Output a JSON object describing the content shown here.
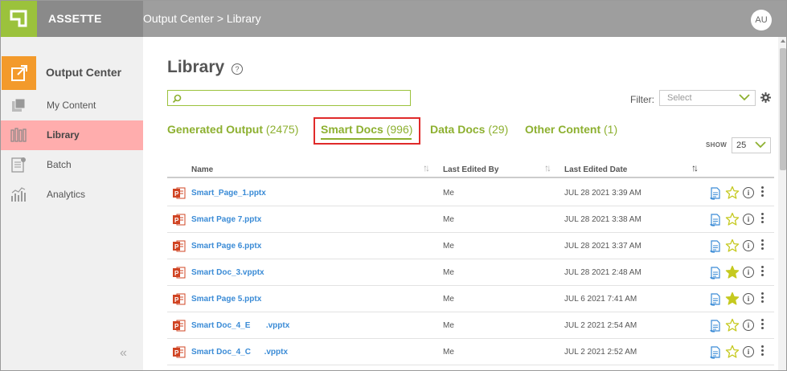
{
  "app": {
    "brand": "ASSETTE",
    "breadcrumb": "Output Center > Library",
    "user_initials": "AU"
  },
  "sidebar": {
    "header": {
      "label": "Output Center",
      "icon": "export-icon",
      "color": "#f39a2b"
    },
    "items": [
      {
        "label": "My Content",
        "icon": "my-content-icon"
      },
      {
        "label": "Library",
        "icon": "library-icon",
        "active": true
      },
      {
        "label": "Batch",
        "icon": "batch-icon"
      },
      {
        "label": "Analytics",
        "icon": "analytics-icon"
      }
    ],
    "collapse_glyph": "«"
  },
  "main": {
    "title": "Library",
    "help_glyph": "?",
    "search": {
      "value": "",
      "placeholder": ""
    },
    "filter": {
      "label": "Filter:",
      "value": "Select"
    },
    "tabs": [
      {
        "label": "Generated Output",
        "count": "(2475)"
      },
      {
        "label": "Smart Docs",
        "count": "(996)",
        "active": true
      },
      {
        "label": "Data Docs",
        "count": "(29)"
      },
      {
        "label": "Other Content",
        "count": "(1)"
      }
    ],
    "show": {
      "label": "SHOW",
      "value": "25"
    },
    "columns": {
      "name": "Name",
      "edited_by": "Last Edited By",
      "edited_date": "Last Edited Date"
    },
    "rows": [
      {
        "name": "Smart_Page_1.pptx",
        "by": "Me",
        "date": "JUL 28 2021 3:39 AM",
        "favorite": false
      },
      {
        "name": "Smart Page 7.pptx",
        "by": "Me",
        "date": "JUL 28 2021 3:38 AM",
        "favorite": false
      },
      {
        "name": "Smart Page 6.pptx",
        "by": "Me",
        "date": "JUL 28 2021 3:37 AM",
        "favorite": false
      },
      {
        "name": "Smart Doc_3.vpptx",
        "by": "Me",
        "date": "JUL 28 2021 2:48 AM",
        "favorite": true
      },
      {
        "name": "Smart Page 5.pptx",
        "by": "Me",
        "date": "JUL 6 2021 7:41 AM",
        "favorite": true
      },
      {
        "name": "Smart Doc_4_E       .vpptx",
        "by": "Me",
        "date": "JUL 2 2021 2:54 AM",
        "favorite": false
      },
      {
        "name": "Smart Doc_4_C      .vpptx",
        "by": "Me",
        "date": "JUL 2 2021 2:52 AM",
        "favorite": false
      }
    ]
  },
  "colors": {
    "accent_green": "#8db030",
    "active_item": "#ffadad",
    "link_blue": "#3a8bd6",
    "highlight_box": "#e02a2a"
  }
}
